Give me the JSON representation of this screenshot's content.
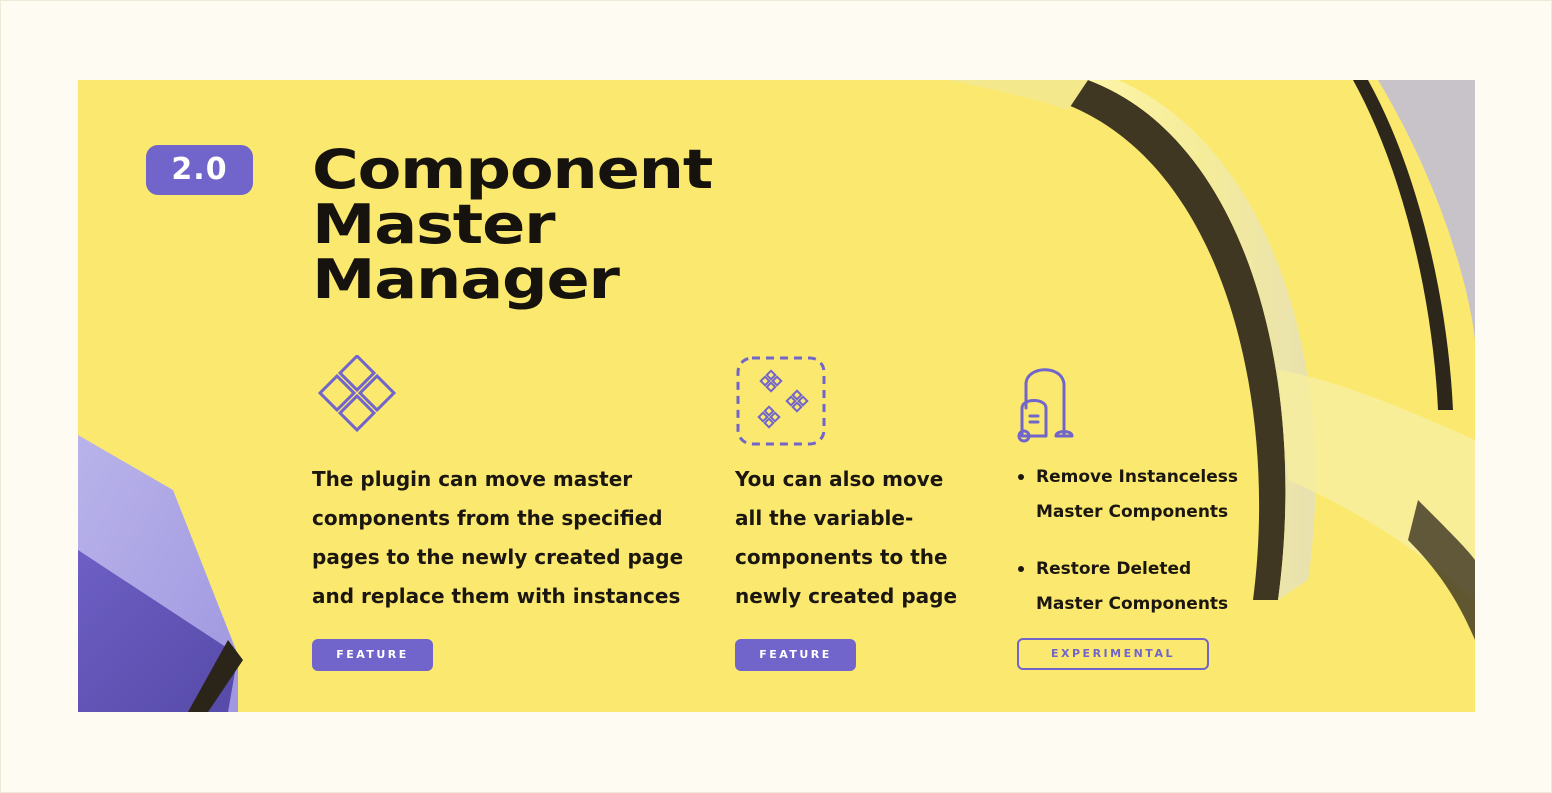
{
  "banner": {
    "version": "2.0",
    "title_lines": [
      "Component",
      "Master",
      "Manager"
    ]
  },
  "features": [
    {
      "icon": "diamond-grid-icon",
      "text_lines": [
        "The plugin can move master",
        "components from the specified",
        "pages to the newly created page",
        "and replace them with instances"
      ],
      "tag": "FEATURE"
    },
    {
      "icon": "dashed-frame-components-icon",
      "text_lines": [
        "You can also move",
        "all the variable-",
        "components to the",
        "newly created page"
      ],
      "tag": "FEATURE"
    },
    {
      "icon": "vacuum-cleaner-icon",
      "bullets": [
        {
          "lines": [
            "Remove Instanceless",
            "Master Components"
          ]
        },
        {
          "lines": [
            "Restore Deleted",
            "Master Components"
          ]
        }
      ],
      "tag": "EXPERIMENTAL"
    }
  ],
  "colors": {
    "banner_background": "#fbe96f",
    "accent": "#7165cb",
    "text": "#16130f",
    "page_background": "#fefcf2"
  }
}
